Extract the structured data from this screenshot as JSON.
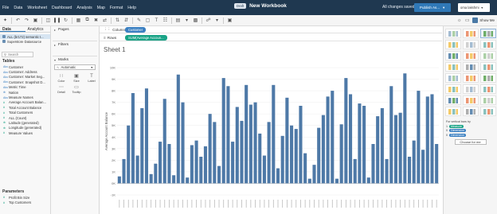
{
  "menu": [
    "File",
    "Data",
    "Worksheet",
    "Dashboard",
    "Analysis",
    "Map",
    "Format",
    "Help"
  ],
  "header": {
    "draft_badge": "Draft",
    "title": "New Workbook",
    "save_status": "All changes saved",
    "publish_label": "Publish As...",
    "user_label": "oma lakshmi"
  },
  "toolbar": {
    "show_me_label": "Show Me"
  },
  "data_pane": {
    "tab_data": "Data",
    "tab_analytics": "Analytics",
    "datasources": [
      "ALL (br172) semantic t...",
      "Superstore Datasource"
    ],
    "search_placeholder": "Search",
    "tables_label": "Tables",
    "fields": [
      {
        "type": "Abc",
        "kind": "dim",
        "name": "Customer"
      },
      {
        "type": "Abc",
        "kind": "dim",
        "name": "Customer: Address"
      },
      {
        "type": "Abc",
        "kind": "dim",
        "name": "Customer: Market Seg..."
      },
      {
        "type": "Abc",
        "kind": "dim",
        "name": "Customer: Snapshot D..."
      },
      {
        "type": "Abc",
        "kind": "dim",
        "name": "Metric Time"
      },
      {
        "type": "⊕",
        "kind": "dim",
        "name": "Nation"
      },
      {
        "type": "Abc",
        "kind": "dim",
        "name": "Measure Names"
      },
      {
        "type": "#",
        "kind": "mea",
        "name": "Average Account Balan..."
      },
      {
        "type": "#",
        "kind": "mea",
        "name": "Total Account Balance"
      },
      {
        "type": "#",
        "kind": "mea",
        "name": "Total Customers"
      },
      {
        "type": "#",
        "kind": "mea",
        "name": "ALL (Count)"
      },
      {
        "type": "⊕",
        "kind": "mea",
        "name": "Latitude (generated)"
      },
      {
        "type": "⊕",
        "kind": "mea",
        "name": "Longitude (generated)"
      },
      {
        "type": "#",
        "kind": "mea",
        "name": "Measure Values"
      }
    ],
    "parameters_label": "Parameters",
    "parameters": [
      {
        "type": "#",
        "name": "Profit Bin Size"
      },
      {
        "type": "#",
        "name": "Top Customers"
      }
    ]
  },
  "cards": {
    "pages": "Pages",
    "filters": "Filters",
    "marks": "Marks",
    "mark_type": "Automatic",
    "mark_buttons": [
      {
        "icon": "∷",
        "label": "Color"
      },
      {
        "icon": "▣",
        "label": "Size"
      },
      {
        "icon": "T",
        "label": "Label"
      },
      {
        "icon": "⋯",
        "label": "Detail"
      },
      {
        "icon": "▭",
        "label": "Tooltip"
      }
    ]
  },
  "shelves": {
    "columns_label": "Columns",
    "rows_label": "Rows",
    "columns_pill": "Customer",
    "rows_pill": "SUM(Average Accoun..."
  },
  "sheet": {
    "title": "Sheet 1"
  },
  "chart_data": {
    "type": "bar",
    "ylabel": "Average Account Balance",
    "yticks": [
      "10K",
      "9K",
      "8K",
      "7K",
      "6K",
      "5K",
      "4K",
      "3K",
      "2K",
      "1K",
      "0K",
      "-1K"
    ],
    "ylim": [
      -1000,
      10000
    ],
    "values": [
      600,
      2100,
      5000,
      7800,
      2400,
      6500,
      8200,
      800,
      1700,
      3600,
      7300,
      3400,
      700,
      9400,
      7000,
      500,
      3300,
      3700,
      2300,
      3200,
      6000,
      5300,
      1500,
      9100,
      8400,
      3600,
      6600,
      5400,
      8500,
      6800,
      7000,
      4300,
      2400,
      5300,
      8500,
      1300,
      4100,
      7400,
      5000,
      4700,
      6700,
      2600,
      400,
      1600,
      4800,
      5900,
      7500,
      8000,
      400,
      5100,
      9100,
      7700,
      2100,
      6900,
      6700,
      500,
      3400,
      5800,
      6500,
      2100,
      8400,
      5900,
      6100,
      9500,
      2300,
      3700,
      8000,
      2900,
      7500,
      7700,
      3400
    ]
  },
  "show_me": {
    "hint": "For vertical bars try",
    "needs": [
      {
        "num": "1",
        "label": "Measure",
        "kind": "mea"
      },
      {
        "num": "0",
        "label": "Dimension",
        "kind": "dim"
      },
      {
        "num": "0",
        "label": "Dimension",
        "kind": "dim"
      }
    ],
    "choose_label": "Choose for me"
  }
}
